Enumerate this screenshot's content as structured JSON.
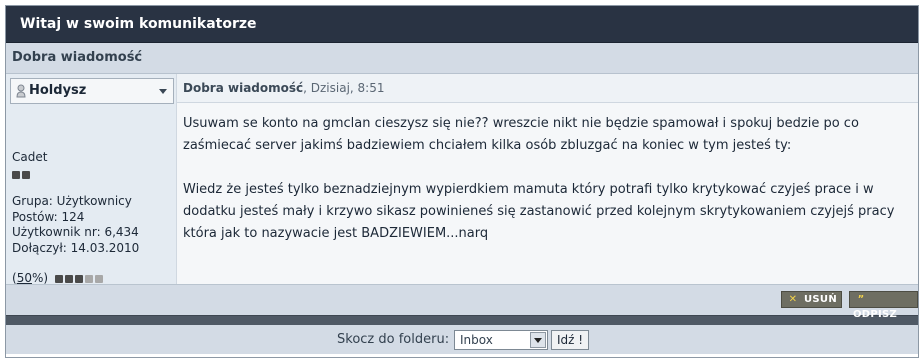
{
  "window": {
    "title": "Witaj w swoim komunikatorze"
  },
  "message": {
    "subject": "Dobra wiadomość"
  },
  "author": {
    "name": "Holdysz",
    "rank": "Cadet",
    "rank_pips": {
      "filled": 2,
      "total": 2
    },
    "stats": [
      "Grupa: Użytkownicy",
      "Postów: 124",
      "Użytkownik nr: 6,434",
      "Dołączył: 14.03.2010"
    ],
    "reputation": {
      "open": "(",
      "percent": "50",
      "close": "%)",
      "pips_filled": 3,
      "pips_total": 5
    }
  },
  "post": {
    "title": "Dobra wiadomość",
    "date": ", Dzisiaj, 8:51",
    "paragraphs": [
      "Usuwam se konto na gmclan cieszysz się nie?? wreszcie nikt nie będzie spamował i spokuj bedzie po co zaśmiecać server jakimś badziewiem chciałem kilka osób zbluzgać na koniec w tym jesteś ty:",
      "Wiedz że jesteś tylko beznadziejnym wypierdkiem mamuta który potrafi tylko krytykować czyjeś prace i w dodatku jesteś mały i krzywo sikasz powinieneś się zastanowić przed kolejnym skrytykowaniem czyjejś pracy która jak to nazywacie jest BADZIEWIEM...narq"
    ]
  },
  "actions": {
    "delete_label": "USUŃ",
    "delete_icon": "x-icon",
    "reply_label": "ODPISZ",
    "reply_icon": "quote-icon"
  },
  "footer": {
    "jump_label": "Skocz do folderu:",
    "folder_selected": "Inbox",
    "go_label": "Idź !"
  },
  "colors": {
    "titlebar": "#293343",
    "subbar": "#d3dbe5",
    "author_panel": "#e4ebf2",
    "button_bg": "#6e6e62",
    "button_icon": "#f2d24a"
  }
}
